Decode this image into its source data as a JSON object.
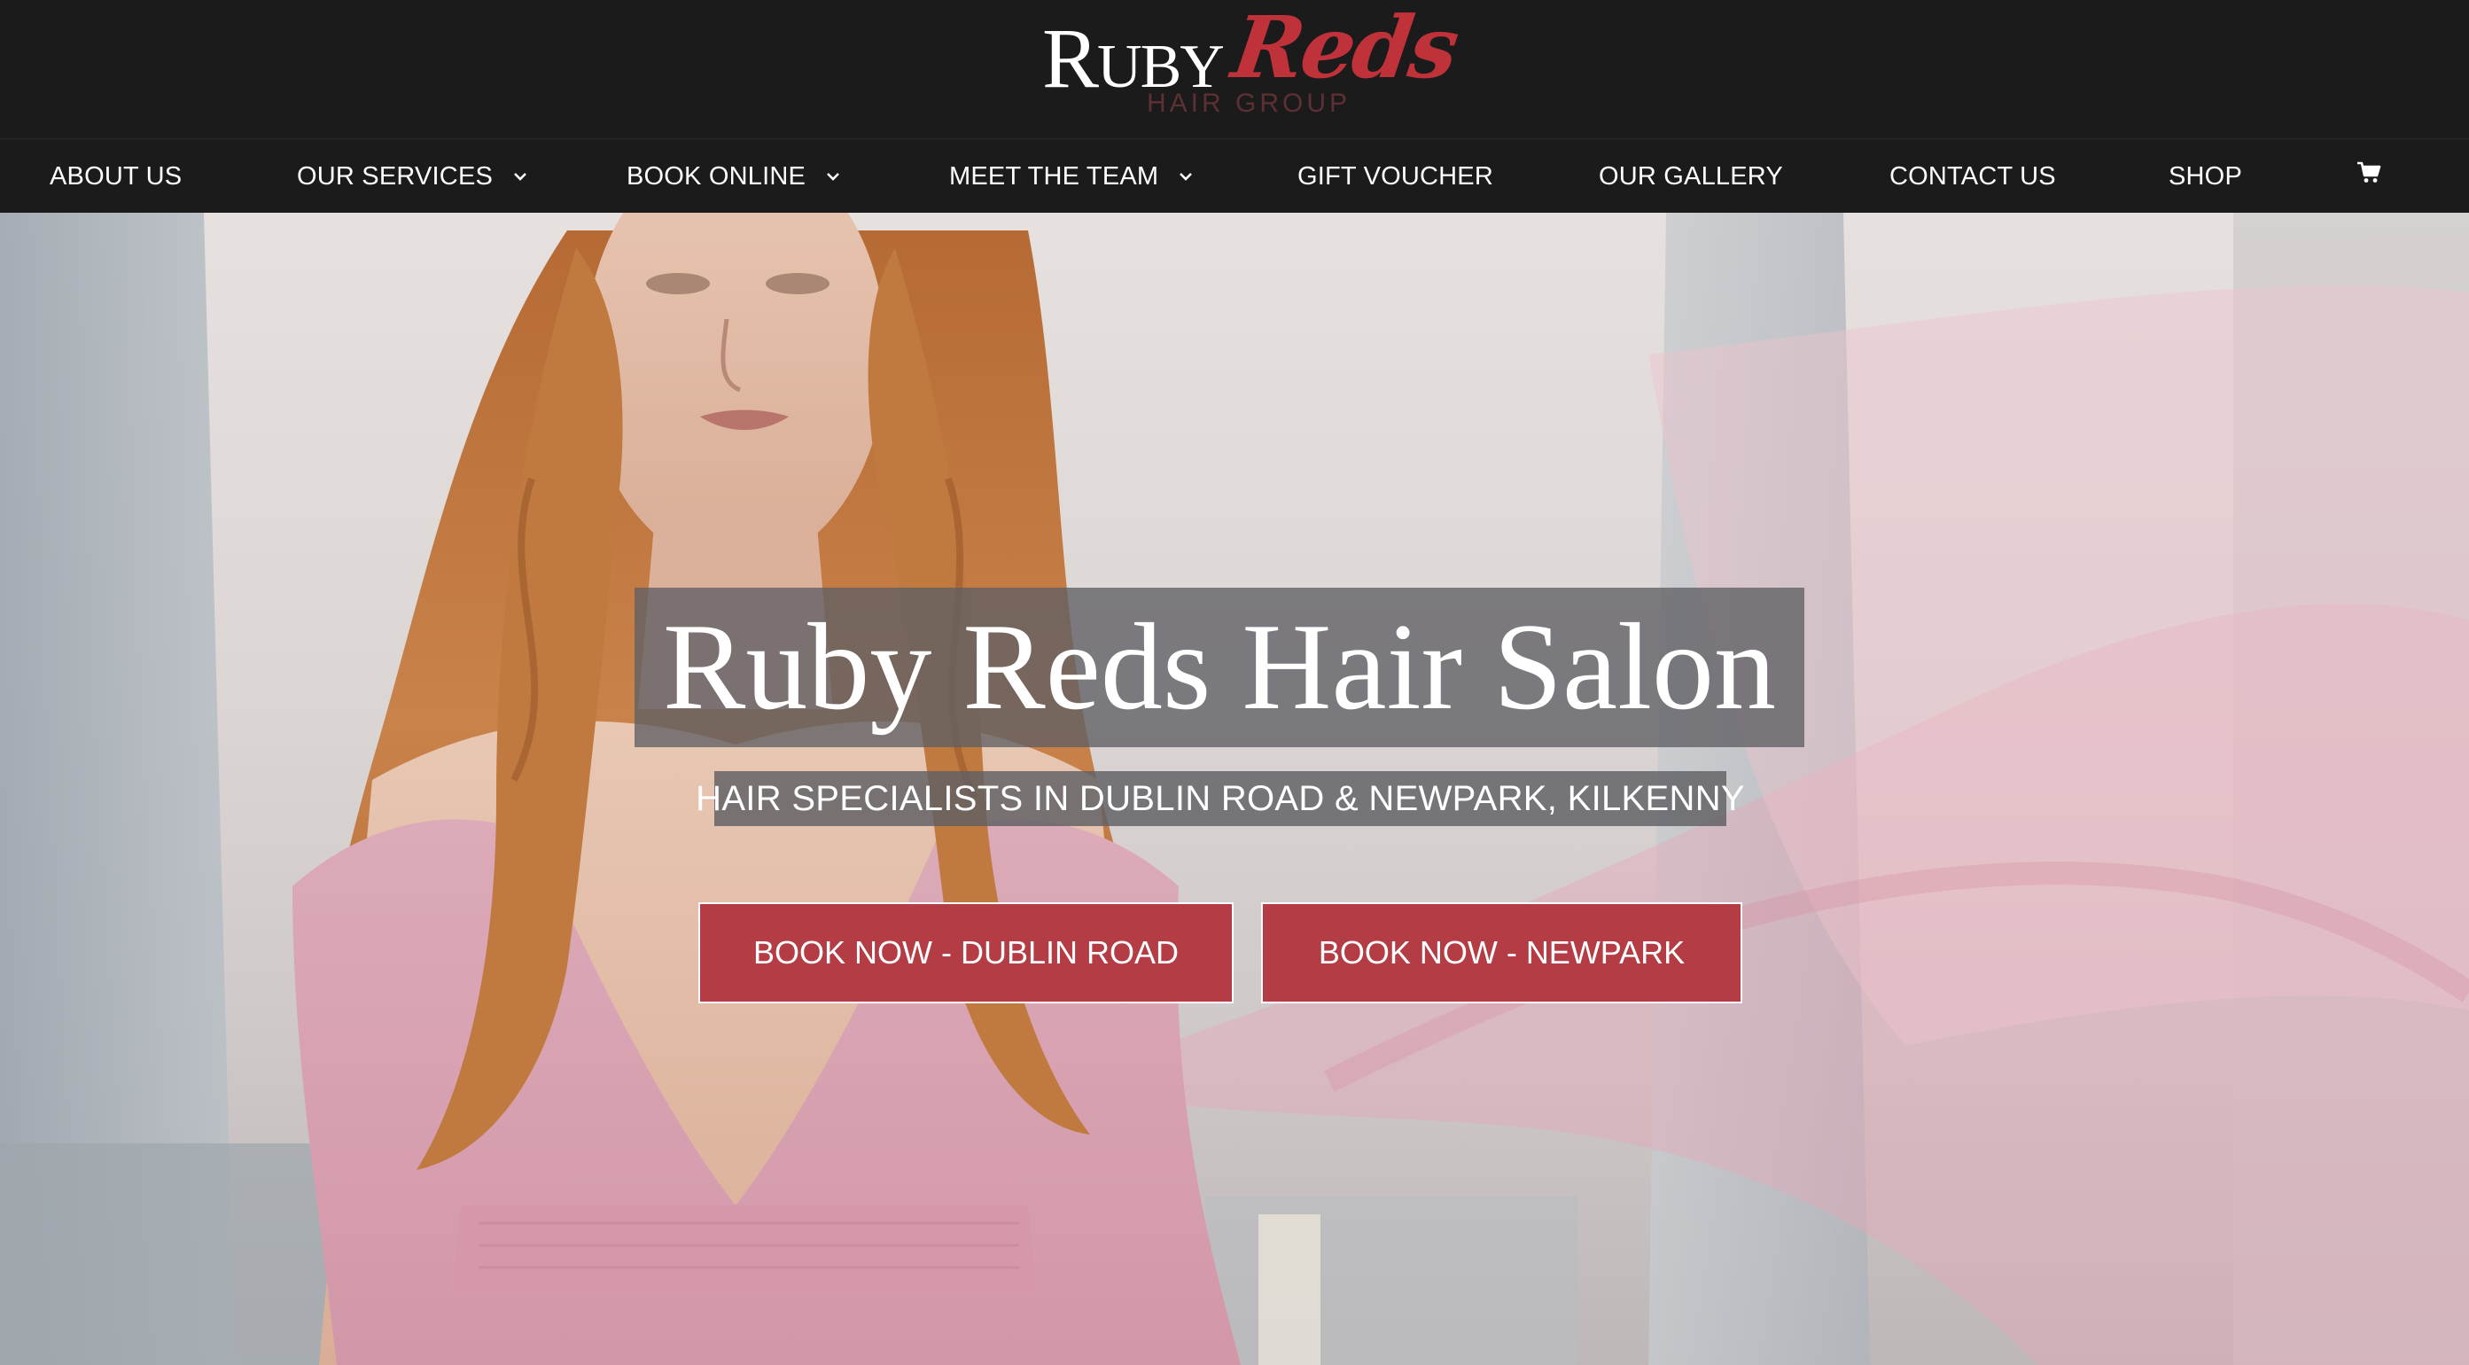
{
  "brand": {
    "logo_ruby_first": "R",
    "logo_ruby_rest": "UBY",
    "logo_reds": "Reds",
    "logo_group": "HAIR GROUP"
  },
  "nav": {
    "items": [
      {
        "label": "ABOUT US",
        "has_dropdown": false
      },
      {
        "label": "OUR SERVICES",
        "has_dropdown": true
      },
      {
        "label": "BOOK ONLINE",
        "has_dropdown": true
      },
      {
        "label": "MEET THE TEAM",
        "has_dropdown": true
      },
      {
        "label": "GIFT VOUCHER",
        "has_dropdown": false
      },
      {
        "label": "OUR GALLERY",
        "has_dropdown": false
      },
      {
        "label": "CONTACT US",
        "has_dropdown": false
      },
      {
        "label": "SHOP",
        "has_dropdown": false
      }
    ],
    "cart_icon": "shopping-cart-icon"
  },
  "hero": {
    "title": "Ruby Reds Hair Salon",
    "subtitle": "HAIR SPECIALISTS IN DUBLIN ROAD & NEWPARK, KILKENNY",
    "cta_dublin": "BOOK NOW - DUBLIN ROAD",
    "cta_newpark": "BOOK NOW - NEWPARK"
  },
  "colors": {
    "header_bg": "#1c1b1c",
    "brand_red": "#c0323a",
    "button_red": "#b43d45",
    "overlay_grey": "#5f5f64"
  }
}
